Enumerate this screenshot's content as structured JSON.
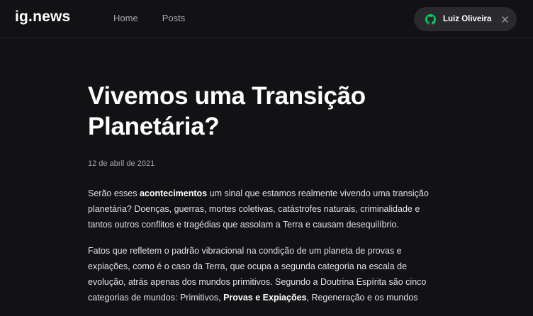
{
  "header": {
    "logo": "ig.news",
    "nav": [
      {
        "label": "Home"
      },
      {
        "label": "Posts"
      }
    ],
    "user": {
      "name": "Luiz Oliveira",
      "icon": "github-icon",
      "icon_color": "#04d361",
      "close_icon": "close-icon"
    }
  },
  "post": {
    "title": "Vivemos uma Transição Planetária?",
    "date": "12 de abril de 2021",
    "p1": {
      "before": "Serão esses ",
      "bold": "acontecimentos",
      "after": " um sinal que estamos realmente vivendo uma transição planetária? Doenças, guerras, mortes coletivas, catástrofes naturais, criminalidade e tantos outros conflitos e tragédias que assolam a Terra e causam desequilíbrio."
    },
    "p2": {
      "before": "Fatos que refletem o padrão vibracional na condição de um planeta de provas e expiações, como é o caso da Terra, que ocupa a segunda categoria na escala de evolução, atrás apenas dos mundos primitivos. Segundo a Doutrina Espírita são cinco categorias de mundos: Primitivos, ",
      "bold": "Provas e Expiações",
      "after": ", Regeneração e os mundos"
    }
  },
  "colors": {
    "background": "#121214",
    "header_border": "#29292e",
    "text": "#e1e1e6",
    "muted": "#a8a8b3",
    "accent_green": "#04d361"
  }
}
